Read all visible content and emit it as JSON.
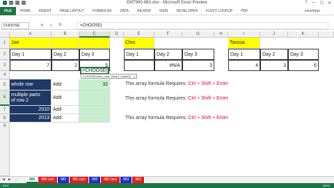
{
  "window": {
    "title": "EMT980-983.xlsx - Microsoft Excel Preview",
    "controls": [
      "?",
      "—",
      "☐",
      "✕"
    ]
  },
  "ribbon": {
    "tabs": [
      "FILE",
      "HOME",
      "INSERT",
      "PAGE LAYOUT",
      "FORMULAS",
      "DATA",
      "REVIEW",
      "VIEW",
      "DEVELOPER",
      "FUZZY LOOKUP",
      "PDF"
    ],
    "user": "excelisfun"
  },
  "formula_bar": {
    "name_box": "CHOOSE",
    "cancel": "✕",
    "enter": "✓",
    "fx": "fx",
    "content": "=CHOOSE("
  },
  "columns": [
    "A",
    "B",
    "C",
    "D",
    "E",
    "F",
    "G",
    "H",
    "I",
    "J",
    "K"
  ],
  "rows": [
    "1",
    "2",
    "3",
    "4",
    "5",
    "6",
    "7",
    "8",
    "9"
  ],
  "cells": {
    "A1": "Joe",
    "E1": "Chin",
    "I1": "Tanisia",
    "A2": "Day 1",
    "B2": "Day 2",
    "C2": "Day 3",
    "E2": "Day 1",
    "F2": "Day 2",
    "G2": "Day 3",
    "I2": "Day 1",
    "J2": "Day 2",
    "K2": "Day 3",
    "A3": "7",
    "B3": "2",
    "C3": "5",
    "E3": "",
    "F3": "#N/A",
    "G3": "3",
    "I3": "4",
    "J3": "3",
    "K3": "6",
    "A5": "whole row",
    "B5": "Add",
    "C5": "32",
    "A6": "multiple parts\nof row 2",
    "B6": "Add",
    "C6": "=CHOOSE(",
    "A7": "2010",
    "B7": "Add",
    "A8": "2013",
    "B8": "Add"
  },
  "notes": {
    "row5": {
      "prefix": "This array formula Requires: ",
      "keys": "Ctrl + Shift + Enter"
    },
    "row6": {
      "prefix": "This array formula Requires: ",
      "keys": "Ctrl + Shift + Enter"
    },
    "row8": {
      "prefix": "This array formula Requires: ",
      "keys": "Ctrl + Shift + Enter"
    }
  },
  "tooltip": "CHOOSE(index_num, value1, [value2], ...)",
  "sheets": {
    "nav": [
      "◀",
      "▶",
      "…"
    ],
    "tabs": [
      "980",
      "980 (an)",
      "981",
      "981 (an)",
      "982",
      "982 (an)",
      "983",
      "983"
    ]
  },
  "status": {
    "mode": "EDIT",
    "zoom": "250%"
  },
  "colors": {
    "excel_green": "#217346",
    "note_red": "#e0004d",
    "navy": "#1f3864",
    "yellow": "#ffff00"
  }
}
